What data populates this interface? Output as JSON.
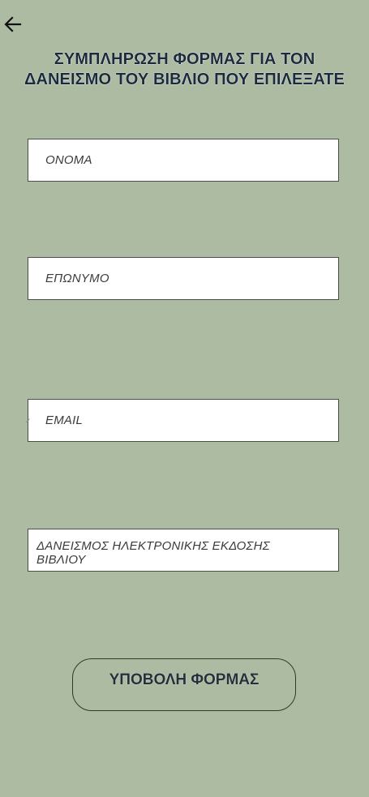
{
  "header": {
    "back_icon": "arrow-left-icon",
    "title": "ΣΥΜΠΛΗΡΩΣΗ ΦΟΡΜΑΣ ΓΙΑ ΤΟΝ\nΔΑΝΕΙΣΜΟ ΤΟΥ ΒΙΒΛΙΟ ΠΟΥ ΕΠΙΛΕΞΑΤΕ"
  },
  "form": {
    "name_placeholder": "ΟΝΟΜΑ",
    "surname_placeholder": "ΕΠΩΝΥΜΟ",
    "email_placeholder": "EMAIL",
    "email_prefix_mark": "✓",
    "loan_type_value": "ΔΑΝΕΙΣΜΟΣ ΗΛΕΚΤΡΟΝΙΚΗΣ ΕΚΔΟΣΗΣ\n ΒΙΒΛΙΟΥ",
    "submit_label": "ΥΠΟΒΟΛΗ ΦΟΡΜΑΣ"
  },
  "colors": {
    "background": "#adbba3",
    "title_text": "#1c2a3d",
    "field_background": "#ffffff",
    "field_border": "#4a4f45"
  }
}
